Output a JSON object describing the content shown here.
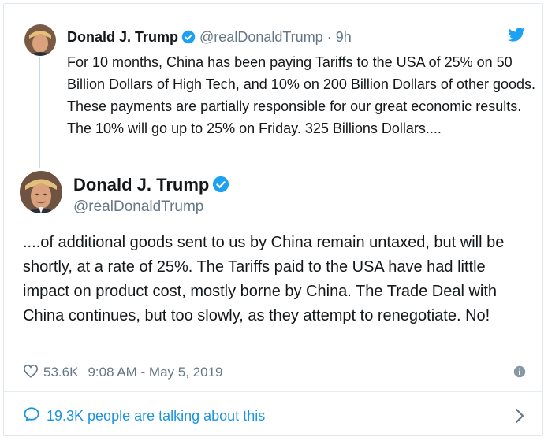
{
  "quoted_tweet": {
    "author_name": "Donald J. Trump",
    "handle": "@realDonaldTrump",
    "separator": "·",
    "time": "9h",
    "text": "For 10 months, China has been paying Tariffs to the USA of 25% on 50 Billion Dollars of High Tech, and 10% on 200 Billion Dollars of other goods. These payments are partially responsible for our great economic results. The 10% will go up to 25% on Friday. 325 Billions Dollars...."
  },
  "main_tweet": {
    "author_name": "Donald J. Trump",
    "handle": "@realDonaldTrump",
    "text": "....of additional goods sent to us by China remain untaxed, but will be shortly, at a rate of 25%. The Tariffs paid to the USA have had little impact on product cost, mostly borne by China. The Trade Deal with China continues, but too slowly, as they attempt to renegotiate. No!",
    "likes": "53.6K",
    "timestamp": "9:08 AM - May 5, 2019"
  },
  "footer": {
    "talking_text": "19.3K people are talking about this"
  },
  "icons": {
    "verified": "verified-badge-icon",
    "bird": "twitter-bird-icon",
    "like": "heart-icon",
    "info": "info-icon",
    "reply": "speech-bubble-icon",
    "chevron": "chevron-right-icon"
  },
  "colors": {
    "text": "#14171a",
    "secondary": "#657786",
    "accent": "#1da1f2",
    "link": "#1b95e0",
    "border": "#e1e8ed"
  }
}
